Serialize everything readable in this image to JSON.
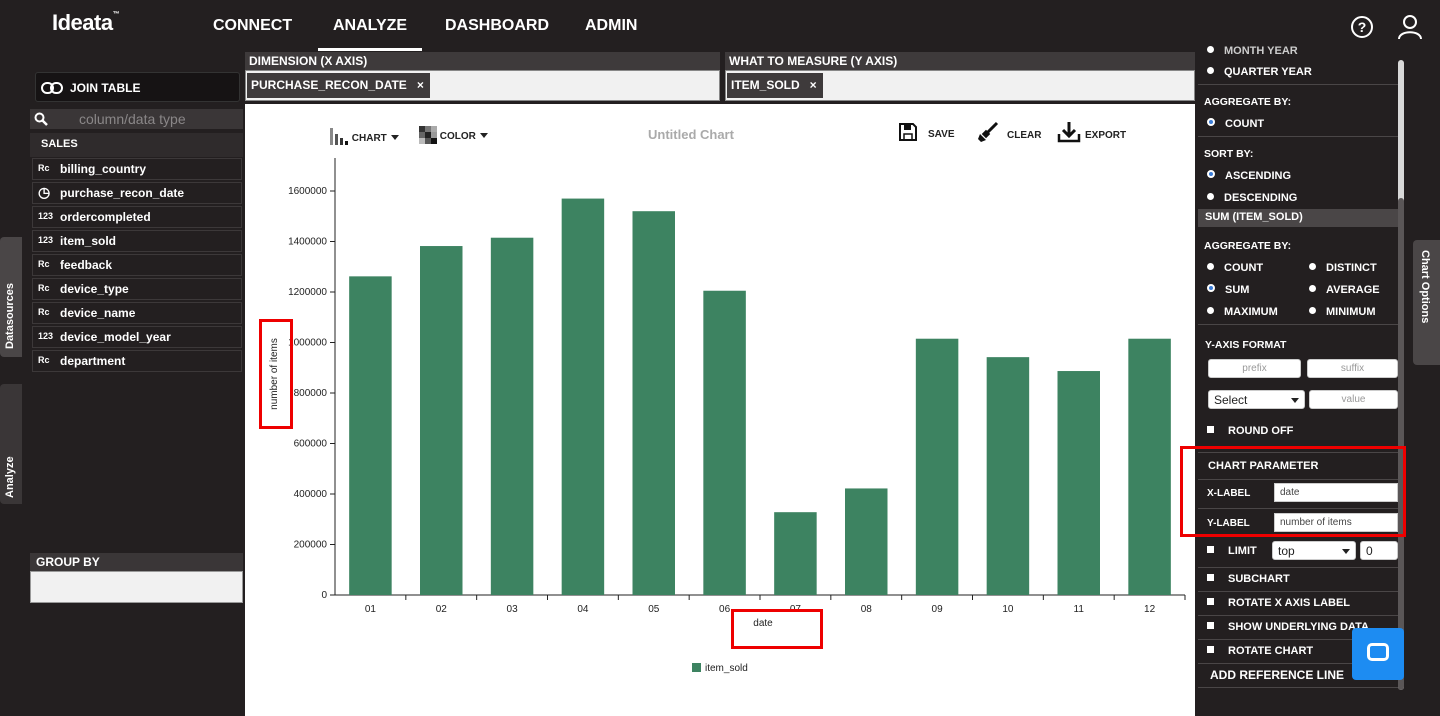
{
  "app": {
    "logo": "Ideata"
  },
  "nav": {
    "items": [
      "CONNECT",
      "ANALYZE",
      "DASHBOARD",
      "ADMIN"
    ],
    "active": "ANALYZE"
  },
  "header_icons": {
    "help": "help-icon",
    "user": "user-icon"
  },
  "left_panel": {
    "join_table": "JOIN TABLE",
    "search_placeholder": "column/data type",
    "table_name": "SALES",
    "fields": [
      {
        "name": "billing_country",
        "type": "text"
      },
      {
        "name": "purchase_recon_date",
        "type": "date"
      },
      {
        "name": "ordercompleted",
        "type": "number"
      },
      {
        "name": "item_sold",
        "type": "number"
      },
      {
        "name": "feedback",
        "type": "text"
      },
      {
        "name": "device_type",
        "type": "text"
      },
      {
        "name": "device_name",
        "type": "text"
      },
      {
        "name": "device_model_year",
        "type": "number"
      },
      {
        "name": "department",
        "type": "text"
      }
    ],
    "group_by": "GROUP BY",
    "tabs": {
      "datasources": "Datasources",
      "analyze": "Analyze"
    }
  },
  "dimension": {
    "label": "DIMENSION (X AXIS)",
    "pill": "PURCHASE_RECON_DATE",
    "remove": "×"
  },
  "measure": {
    "label": "WHAT TO MEASURE (Y AXIS)",
    "pill": "ITEM_SOLD",
    "remove": "×"
  },
  "toolbar": {
    "chart": "CHART",
    "color": "COLOR",
    "title": "Untitled Chart",
    "save": "SAVE",
    "clear": "CLEAR",
    "export": "EXPORT"
  },
  "chart_data": {
    "type": "bar",
    "categories": [
      "01",
      "02",
      "03",
      "04",
      "05",
      "06",
      "07",
      "08",
      "09",
      "10",
      "11",
      "12"
    ],
    "series": [
      {
        "name": "item_sold",
        "color": "#3d8361",
        "values": [
          1262000,
          1382000,
          1415000,
          1570000,
          1520000,
          1205000,
          328000,
          422000,
          1015000,
          942000,
          887000,
          1015000
        ]
      }
    ],
    "xlabel": "date",
    "ylabel": "number of items",
    "ylim": [
      0,
      1600000
    ],
    "yticks": [
      0,
      200000,
      400000,
      600000,
      800000,
      1000000,
      1200000,
      1400000,
      1600000
    ],
    "ytick_labels": [
      "0",
      "200000",
      "400000",
      "600000",
      "800000",
      "1000000",
      "1200000",
      "1400000",
      "1600000"
    ],
    "legend_position": "bottom",
    "grid": false
  },
  "right_panel": {
    "month_year": "MONTH YEAR",
    "quarter_year": "QUARTER YEAR",
    "aggregate_by_1": "AGGREGATE BY:",
    "count_1": "COUNT",
    "sort_by": "SORT BY:",
    "ascending": "ASCENDING",
    "descending": "DESCENDING",
    "sum_header": "SUM (ITEM_SOLD)",
    "aggregate_by_2": "AGGREGATE BY:",
    "agg_options": [
      "COUNT",
      "DISTINCT",
      "SUM",
      "AVERAGE",
      "MAXIMUM",
      "MINIMUM"
    ],
    "agg_selected": "SUM",
    "y_axis_format": "Y-AXIS FORMAT",
    "prefix_placeholder": "prefix",
    "suffix_placeholder": "suffix",
    "format_select": "Select",
    "value_placeholder": "value",
    "round_off": "ROUND OFF",
    "chart_parameter": "CHART PARAMETER",
    "x_label": "X-LABEL",
    "x_label_value": "date",
    "y_label": "Y-LABEL",
    "y_label_value": "number of items",
    "limit": "LIMIT",
    "limit_select": "top",
    "limit_value": "0",
    "subchart": "SUBCHART",
    "rotate_x": "ROTATE X AXIS LABEL",
    "show_underlying": "SHOW UNDERLYING DATA",
    "rotate_chart": "ROTATE CHART",
    "add_reference": "ADD REFERENCE LINE",
    "chart_options_tab": "Chart Options"
  },
  "colors": {
    "bar": "#3d8361",
    "highlight": "#e00000",
    "chat": "#1d8cf2"
  }
}
